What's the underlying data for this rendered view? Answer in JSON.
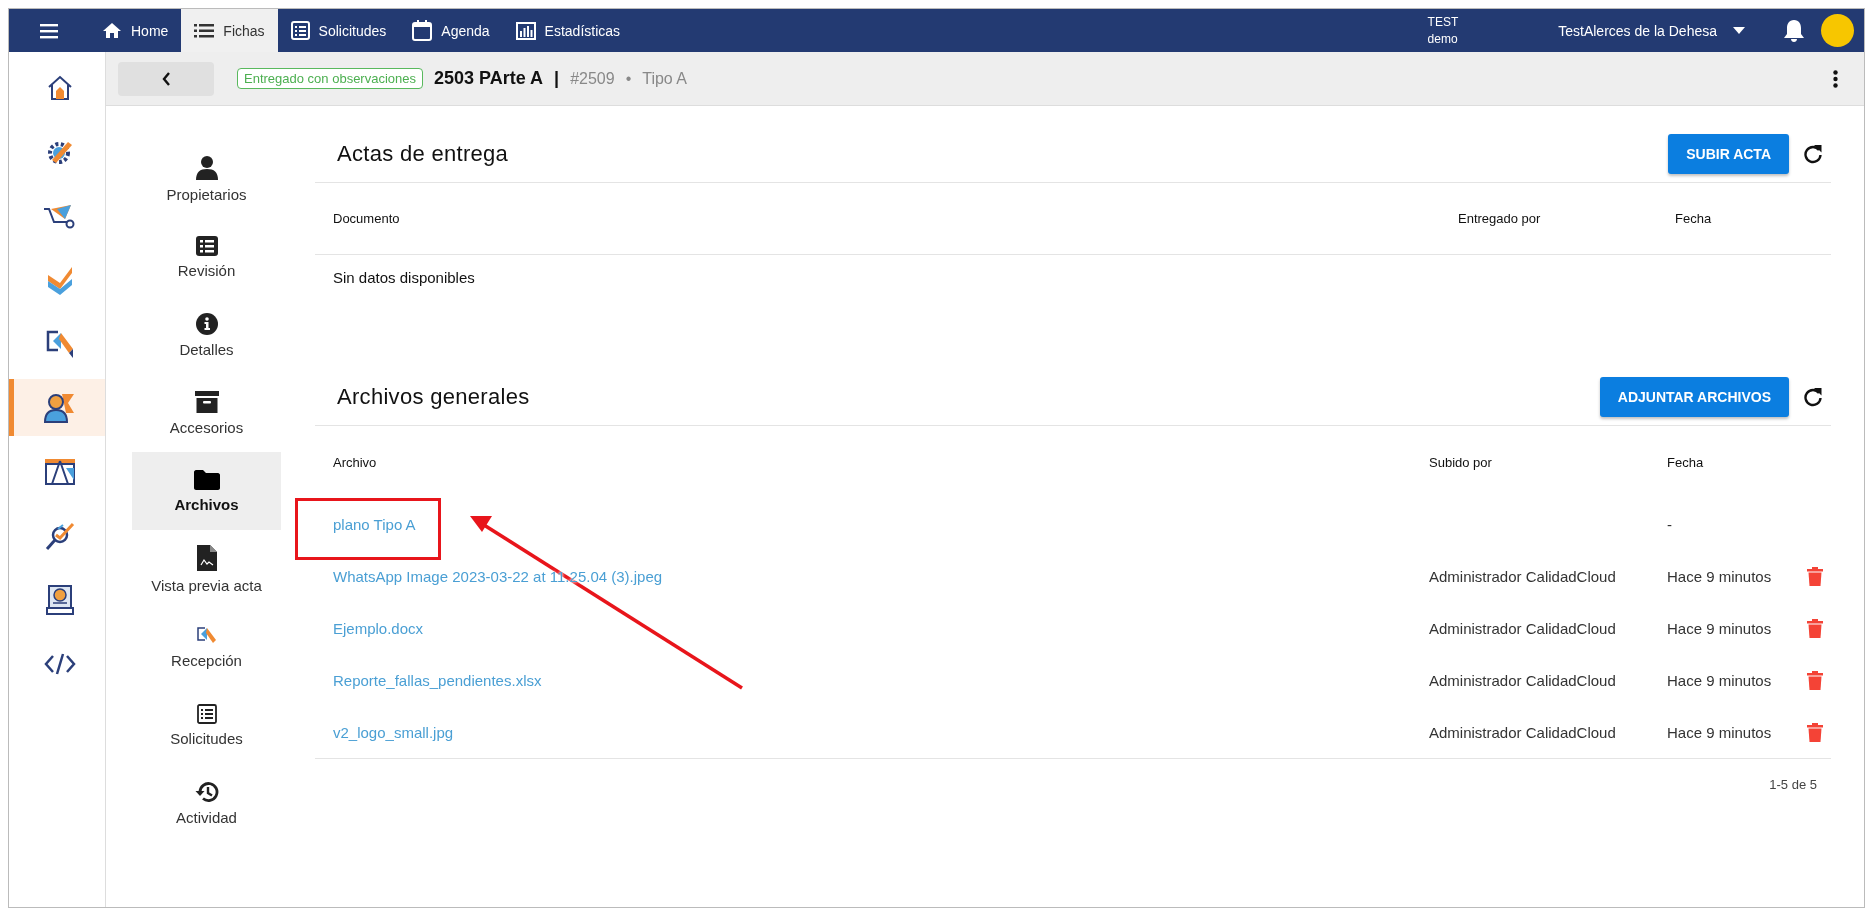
{
  "topbar": {
    "tabs": [
      {
        "label": "Home",
        "selected": false
      },
      {
        "label": "Fichas",
        "selected": true
      },
      {
        "label": "Solicitudes",
        "selected": false
      },
      {
        "label": "Agenda",
        "selected": false
      },
      {
        "label": "Estadísticas",
        "selected": false
      }
    ],
    "environment": {
      "line_1": "TEST",
      "line_2": "demo"
    },
    "project": "TestAlerces de la Dehesa"
  },
  "rail": {
    "items": [
      {
        "selected": false
      },
      {
        "selected": false
      },
      {
        "selected": false
      },
      {
        "selected": false
      },
      {
        "selected": false
      },
      {
        "selected": true
      },
      {
        "selected": false
      },
      {
        "selected": false
      },
      {
        "selected": false
      },
      {
        "selected": false
      }
    ]
  },
  "header": {
    "status": "Entregado con observaciones",
    "title": "2503 PArte A",
    "separator": "|",
    "code": "#2509",
    "bullet": "•",
    "type": "Tipo A"
  },
  "subnav": {
    "items": [
      {
        "label": "Propietarios",
        "selected": false
      },
      {
        "label": "Revisión",
        "selected": false
      },
      {
        "label": "Detalles",
        "selected": false
      },
      {
        "label": "Accesorios",
        "selected": false
      },
      {
        "label": "Archivos",
        "selected": true
      },
      {
        "label": "Vista previa acta",
        "selected": false
      },
      {
        "label": "Recepción",
        "selected": false
      },
      {
        "label": "Solicitudes",
        "selected": false
      },
      {
        "label": "Actividad",
        "selected": false
      }
    ]
  },
  "actas": {
    "title": "Actas de entrega",
    "button": "SUBIR ACTA",
    "columns": [
      "Documento",
      "Entregado por",
      "Fecha"
    ],
    "empty": "Sin datos disponibles"
  },
  "archivos": {
    "title": "Archivos generales",
    "button": "ADJUNTAR ARCHIVOS",
    "columns": [
      "Archivo",
      "Subido por",
      "Fecha"
    ],
    "rows": [
      {
        "file": "plano Tipo A",
        "uploader": "",
        "date": "-",
        "deletable": false,
        "highlighted": true
      },
      {
        "file": "WhatsApp Image 2023-03-22 at 11.25.04 (3).jpeg",
        "uploader": "Administrador CalidadCloud",
        "date": "Hace 9 minutos",
        "deletable": true
      },
      {
        "file": "Ejemplo.docx",
        "uploader": "Administrador CalidadCloud",
        "date": "Hace 9 minutos",
        "deletable": true
      },
      {
        "file": "Reporte_fallas_pendientes.xlsx",
        "uploader": "Administrador CalidadCloud",
        "date": "Hace 9 minutos",
        "deletable": true
      },
      {
        "file": "v2_logo_small.jpg",
        "uploader": "Administrador CalidadCloud",
        "date": "Hace 9 minutos",
        "deletable": true
      }
    ],
    "pagination": "1-5 de 5"
  }
}
